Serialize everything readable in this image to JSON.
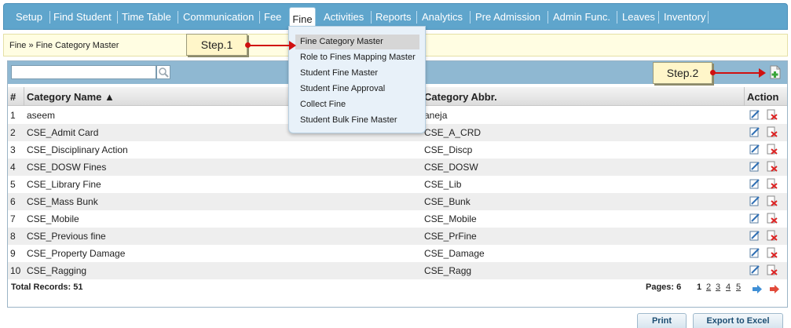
{
  "nav": {
    "items": [
      "Setup",
      "Find Student",
      "Time Table",
      "Communication",
      "Fee",
      "Fine",
      "Activities",
      "Reports",
      "Analytics",
      "Pre Admission",
      "Admin Func.",
      "Leaves",
      "Inventory"
    ],
    "active": "Fine"
  },
  "breadcrumb": "Fine » Fine Category Master",
  "callouts": {
    "step1": "Step.1",
    "step2": "Step.2"
  },
  "dropdown": {
    "items": [
      "Fine Category Master",
      "Role to Fines Mapping Master",
      "Student Fine Master",
      "Student Fine Approval",
      "Collect Fine",
      "Student Bulk Fine Master"
    ],
    "highlighted": "Fine Category Master"
  },
  "search": {
    "value": "",
    "placeholder": ""
  },
  "table": {
    "headers": {
      "num": "#",
      "name": "Category Name ▲",
      "abbr": "Category Abbr.",
      "action": "Action"
    },
    "rows": [
      {
        "n": "1",
        "name": "aseem",
        "abbr": "aneja"
      },
      {
        "n": "2",
        "name": "CSE_Admit Card",
        "abbr": "CSE_A_CRD"
      },
      {
        "n": "3",
        "name": "CSE_Disciplinary Action",
        "abbr": "CSE_Discp"
      },
      {
        "n": "4",
        "name": "CSE_DOSW Fines",
        "abbr": "CSE_DOSW"
      },
      {
        "n": "5",
        "name": "CSE_Library Fine",
        "abbr": "CSE_Lib"
      },
      {
        "n": "6",
        "name": "CSE_Mass Bunk",
        "abbr": "CSE_Bunk"
      },
      {
        "n": "7",
        "name": "CSE_Mobile",
        "abbr": "CSE_Mobile"
      },
      {
        "n": "8",
        "name": "CSE_Previous fine",
        "abbr": "CSE_PrFine"
      },
      {
        "n": "9",
        "name": "CSE_Property Damage",
        "abbr": "CSE_Damage"
      },
      {
        "n": "10",
        "name": "CSE_Ragging",
        "abbr": "CSE_Ragg"
      }
    ]
  },
  "footer": {
    "total": "Total Records: 51",
    "pages_label": "Pages: 6",
    "pages": [
      "1",
      "2",
      "3",
      "4",
      "5"
    ],
    "current_page": "1"
  },
  "buttons": {
    "print": "Print",
    "export": "Export to Excel"
  },
  "colors": {
    "nav_bg": "#5fa5cc",
    "accent_red": "#d01010",
    "callout_bg": "#fff6c9"
  },
  "icons": [
    "search-icon",
    "add-record-icon",
    "edit-icon",
    "delete-icon",
    "next-page-icon",
    "last-page-icon"
  ]
}
